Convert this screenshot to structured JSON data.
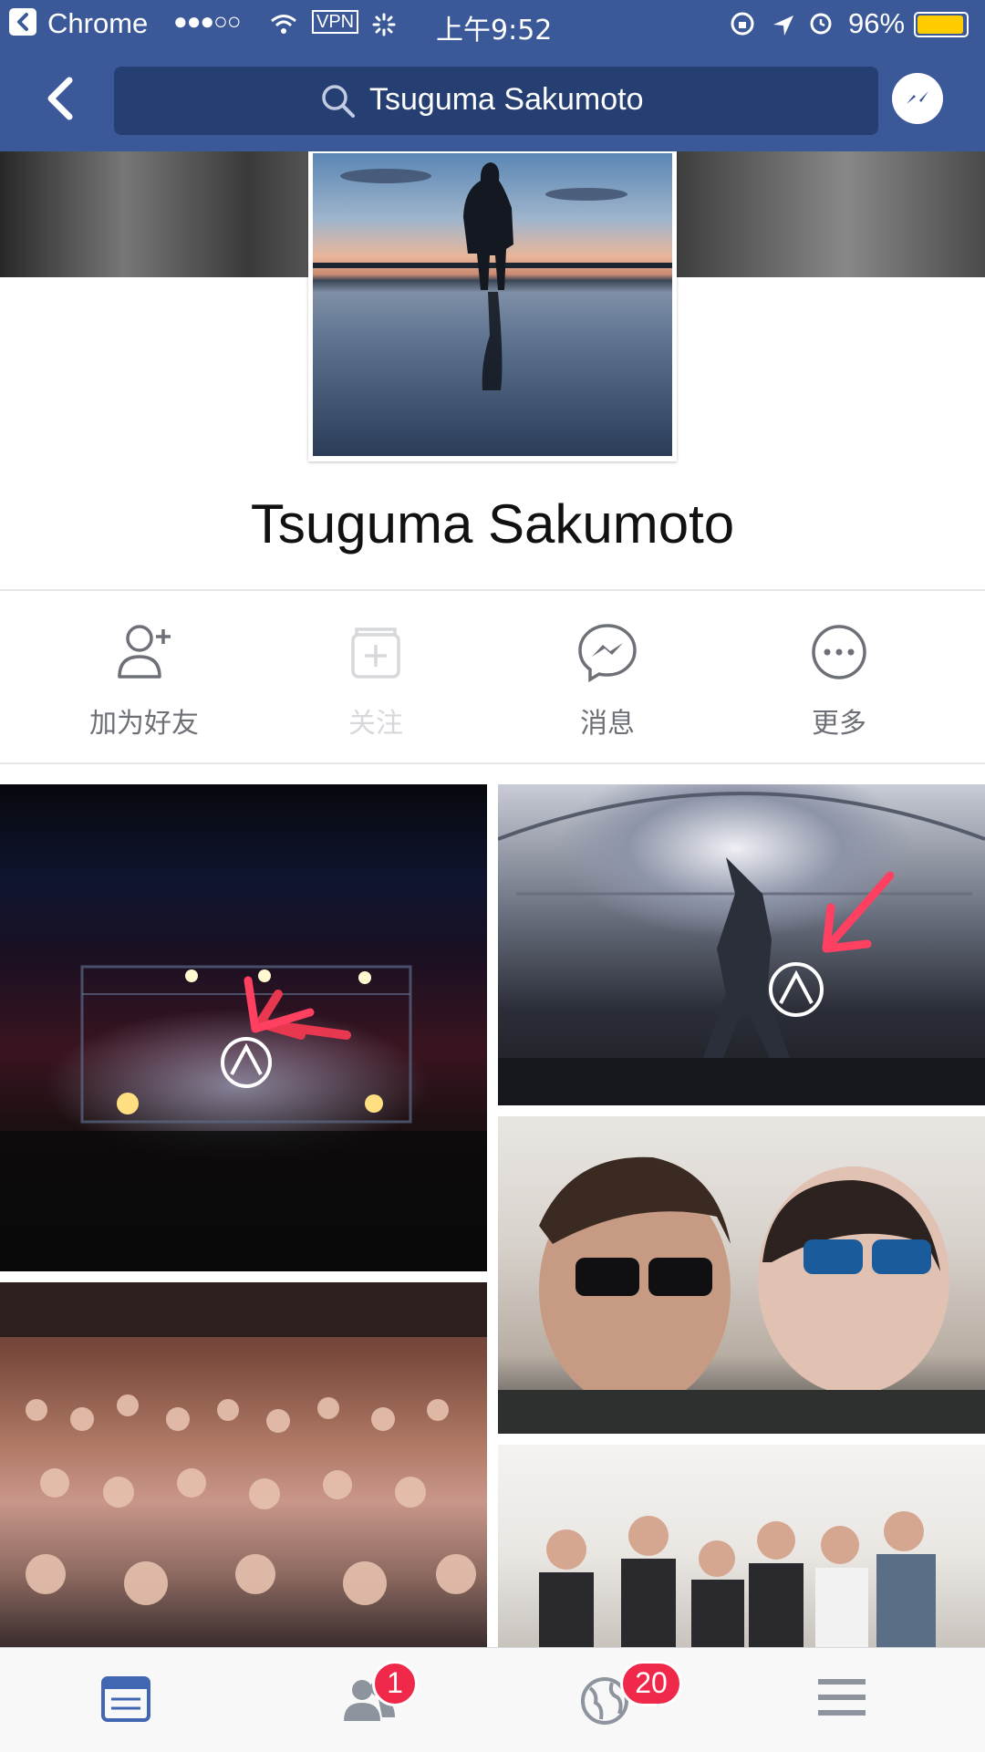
{
  "status_bar": {
    "carrier": "Chrome",
    "signal": "●●●○○",
    "vpn": "VPN",
    "time": "上午9:52",
    "battery": "96%"
  },
  "header": {
    "search_value": "Tsuguma Sakumoto"
  },
  "profile": {
    "name": "Tsuguma Sakumoto"
  },
  "actions": [
    {
      "label": "加为好友",
      "icon": "add-friend-icon"
    },
    {
      "label": "关注",
      "icon": "follow-icon"
    },
    {
      "label": "消息",
      "icon": "messenger-icon"
    },
    {
      "label": "更多",
      "icon": "more-icon"
    }
  ],
  "tabbar": {
    "friends_badge": "1",
    "notifications_badge": "20"
  },
  "colors": {
    "brand": "#3b5998",
    "badge": "#f02849",
    "active_tab": "#4267b2"
  }
}
